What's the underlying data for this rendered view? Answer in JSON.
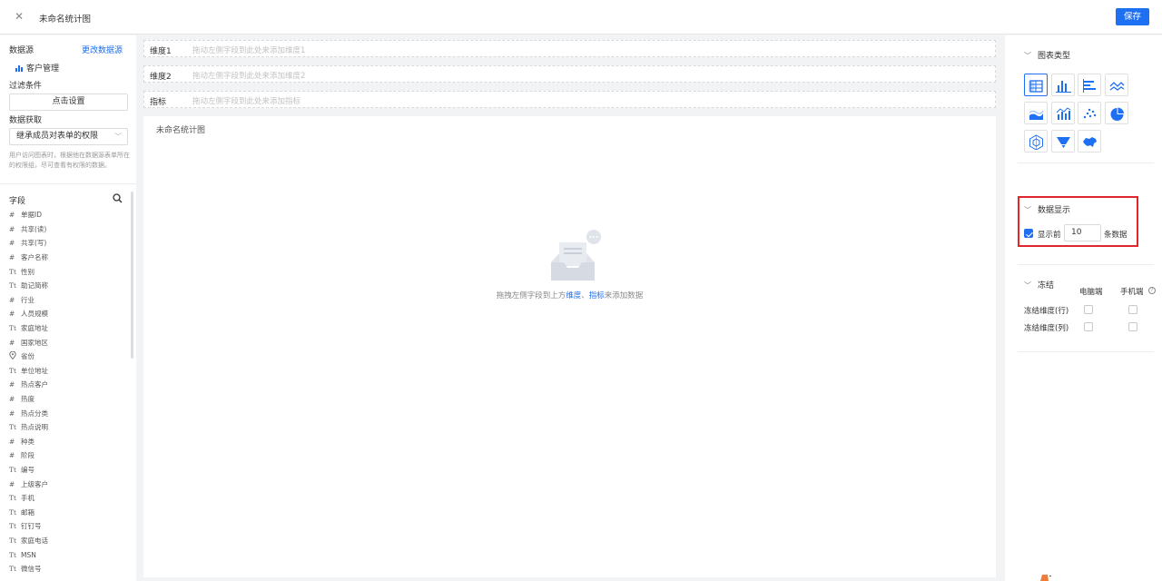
{
  "header": {
    "title": "未命名统计图",
    "save_label": "保存"
  },
  "left": {
    "datasource_label": "数据源",
    "change_source_link": "更改数据源",
    "source_name": "客户管理",
    "filter_label": "过滤条件",
    "filter_button": "点击设置",
    "fetch_label": "数据获取",
    "fetch_value": "继承成员对表单的权限",
    "fetch_note": "用户访问图表时，根据他在数据源表单所在的权限组，尽可查看有权限的数据。",
    "fields_title": "字段",
    "fields": [
      {
        "type": "#",
        "name": "单据ID"
      },
      {
        "type": "#",
        "name": "共享(读)"
      },
      {
        "type": "#",
        "name": "共享(写)"
      },
      {
        "type": "#",
        "name": "客户名称"
      },
      {
        "type": "Tt",
        "name": "性别"
      },
      {
        "type": "Tt",
        "name": "助记简称"
      },
      {
        "type": "#",
        "name": "行业"
      },
      {
        "type": "#",
        "name": "人员规模"
      },
      {
        "type": "Tt",
        "name": "家庭地址"
      },
      {
        "type": "#",
        "name": "国家地区"
      },
      {
        "type": "loc",
        "name": "省份"
      },
      {
        "type": "Tt",
        "name": "单位地址"
      },
      {
        "type": "#",
        "name": "热点客户"
      },
      {
        "type": "#",
        "name": "热度"
      },
      {
        "type": "#",
        "name": "热点分类"
      },
      {
        "type": "Tt",
        "name": "热点说明"
      },
      {
        "type": "#",
        "name": "种类"
      },
      {
        "type": "#",
        "name": "阶段"
      },
      {
        "type": "Tt",
        "name": "编号"
      },
      {
        "type": "#",
        "name": "上级客户"
      },
      {
        "type": "Tt",
        "name": "手机"
      },
      {
        "type": "Tt",
        "name": "邮箱"
      },
      {
        "type": "Tt",
        "name": "钉钉号"
      },
      {
        "type": "Tt",
        "name": "家庭电话"
      },
      {
        "type": "Tt",
        "name": "MSN"
      },
      {
        "type": "Tt",
        "name": "微信号"
      }
    ]
  },
  "center": {
    "dim1_label": "维度1",
    "dim1_placeholder": "拖动左侧字段到此处来添加维度1",
    "dim2_label": "维度2",
    "dim2_placeholder": "拖动左侧字段到此处来添加维度2",
    "metric_label": "指标",
    "metric_placeholder": "拖动左侧字段到此处来添加指标",
    "chart_title": "未命名统计图",
    "empty_prefix": "拖拽左侧字段到上方",
    "empty_dim": "维度",
    "empty_sep": "、",
    "empty_metric": "指标",
    "empty_suffix": "来添加数据"
  },
  "right": {
    "chart_type_title": "图表类型",
    "chart_types": [
      "table",
      "column",
      "bar",
      "line",
      "area",
      "combo",
      "scatter",
      "pie",
      "radar",
      "funnel",
      "map"
    ],
    "data_display_title": "数据显示",
    "show_top_label": "显示前",
    "show_top_value": "10",
    "show_top_suffix": "条数据",
    "show_top_checked": true,
    "freeze_title": "冻结",
    "freeze_pc": "电脑端",
    "freeze_mobile": "手机端",
    "freeze_row": "冻结维度(行)",
    "freeze_col": "冻结维度(列)"
  },
  "colors": {
    "accent": "#1e6ff1",
    "highlight_border": "#e0262b"
  }
}
